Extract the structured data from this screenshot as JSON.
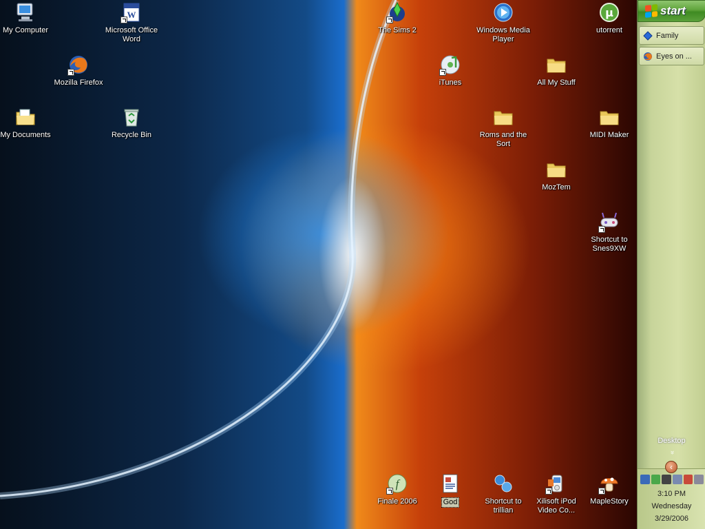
{
  "desktop": {
    "icons": [
      {
        "id": "my-computer",
        "label": "My Computer"
      },
      {
        "id": "ms-word",
        "label": "Microsoft Office Word"
      },
      {
        "id": "firefox",
        "label": "Mozilla Firefox"
      },
      {
        "id": "my-documents",
        "label": "My Documents"
      },
      {
        "id": "recycle-bin",
        "label": "Recycle Bin"
      },
      {
        "id": "sims2",
        "label": "The Sims 2"
      },
      {
        "id": "wmp",
        "label": "Windows Media Player"
      },
      {
        "id": "utorrent",
        "label": "utorrent"
      },
      {
        "id": "itunes",
        "label": "iTunes"
      },
      {
        "id": "all-my-stuff",
        "label": "All My Stuff"
      },
      {
        "id": "roms",
        "label": "Roms and the Sort"
      },
      {
        "id": "midi-maker",
        "label": "MIDI Maker"
      },
      {
        "id": "moztem",
        "label": "MozTem"
      },
      {
        "id": "snes9x",
        "label": "Shortcut to Snes9XW"
      },
      {
        "id": "finale",
        "label": "Finale 2006"
      },
      {
        "id": "god",
        "label": "God"
      },
      {
        "id": "trillian",
        "label": "Shortcut to trillian"
      },
      {
        "id": "xilisoft",
        "label": "Xilisoft iPod Video Co..."
      },
      {
        "id": "maplestory",
        "label": "MapleStory"
      }
    ]
  },
  "taskbar": {
    "start_label": "start",
    "tasks": [
      {
        "label": "Family",
        "icon": "diamond-icon"
      },
      {
        "label": "Eyes on ...",
        "icon": "firefox-icon"
      }
    ],
    "toolbar_label": "Desktop",
    "chevron": "»",
    "clock": {
      "time": "3:10 PM",
      "day": "Wednesday",
      "date": "3/29/2006"
    }
  },
  "colors": {
    "taskbar": "#c7d49a",
    "start_green": "#3f8a22"
  }
}
